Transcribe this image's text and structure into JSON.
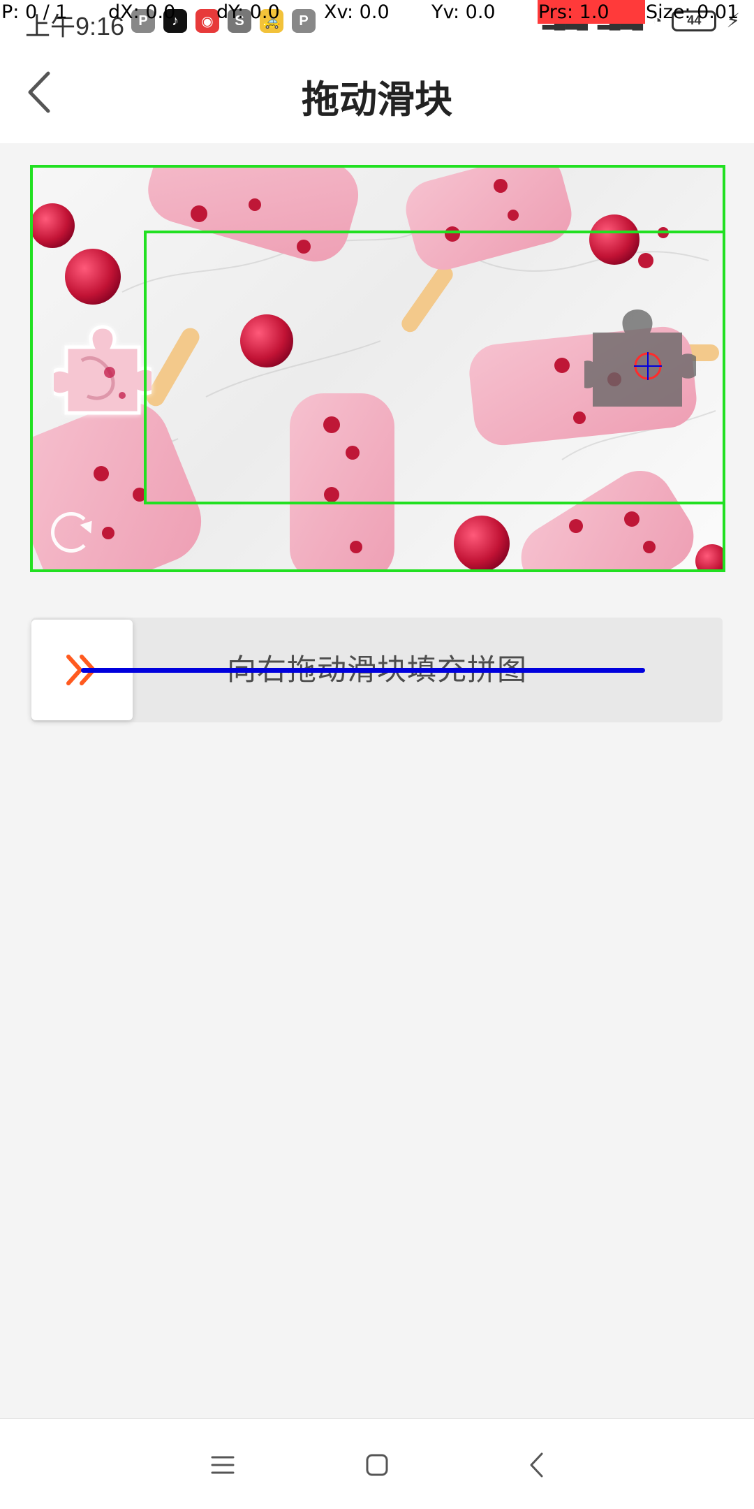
{
  "debug": {
    "pointer": "P: 0 / 1",
    "dx": "dX: 0.0",
    "dy": "dY: 0.0",
    "xv": "Xv: 0.0",
    "yv": "Yv: 0.0",
    "prs": "Prs: 1.0",
    "size": "Size: 0.01"
  },
  "status_bar": {
    "time": "上午9:16",
    "battery": "44",
    "apps": [
      "P",
      "TikTok",
      "Game",
      "S",
      "Taxi",
      "P"
    ]
  },
  "header": {
    "title": "拖动滑块",
    "back_icon": "chevron-left-icon"
  },
  "captcha": {
    "image_description_icon": "popsicle-image",
    "refresh_icon": "refresh-icon"
  },
  "slider": {
    "hint": "向右拖动滑块填充拼图",
    "handle_icon": "double-chevron-right-icon",
    "progress": 0
  },
  "nav": {
    "menu_icon": "menu-icon",
    "home_icon": "square-icon",
    "back_icon": "chevron-left-icon"
  },
  "colors": {
    "accent": "#ff5a1f",
    "frame": "#21e021",
    "drag_line": "#0000dd",
    "debug_prs": "#ff3a3a",
    "background": "#f4f4f4"
  }
}
